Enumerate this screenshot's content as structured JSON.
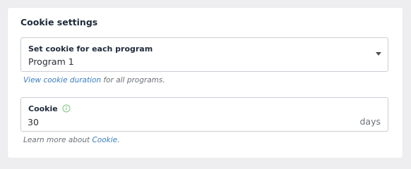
{
  "section": {
    "title": "Cookie settings"
  },
  "program_select": {
    "label": "Set cookie for each program",
    "value": "Program 1"
  },
  "duration_hint": {
    "link_text": "View cookie duration",
    "text": " for all programs."
  },
  "cookie_field": {
    "label": "Cookie",
    "value": "30",
    "suffix": "days",
    "info_icon": "info-icon"
  },
  "learn_more_hint": {
    "text": "Learn more about ",
    "link_text": "Cookie",
    "end": "."
  },
  "colors": {
    "background": "#eeeef0",
    "card": "#ffffff",
    "border": "#c9cdd3",
    "link": "#3a7dc1",
    "info_icon": "#7cc27c",
    "heading": "#1f2a3a"
  }
}
